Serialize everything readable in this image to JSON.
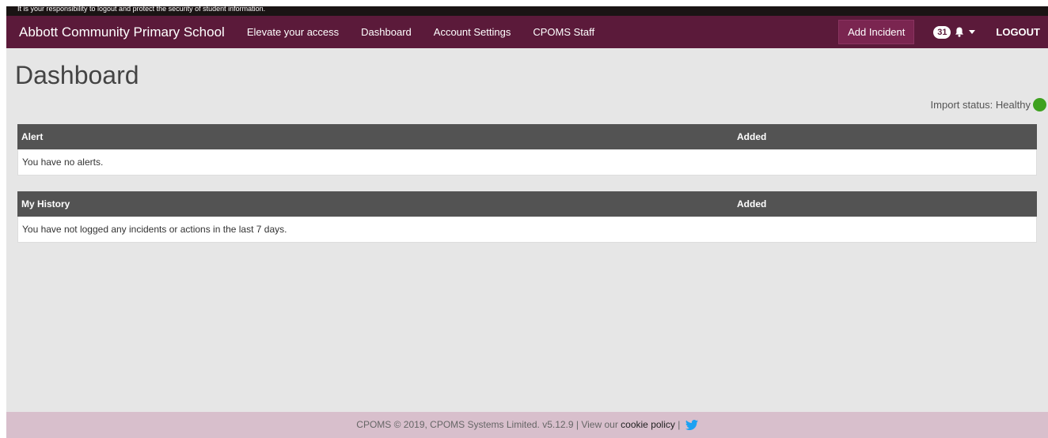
{
  "top_warning": "It is your responsibility to logout and protect the security of student information.",
  "navbar": {
    "brand": "Abbott Community Primary School",
    "links": [
      "Elevate your access",
      "Dashboard",
      "Account Settings",
      "CPOMS Staff"
    ],
    "add_incident": "Add Incident",
    "notification_count": "31",
    "logout": "LOGOUT"
  },
  "page": {
    "title": "Dashboard",
    "import_status": "Import status: Healthy"
  },
  "alerts_panel": {
    "col_a": "Alert",
    "col_b": "Added",
    "empty": "You have no alerts."
  },
  "history_panel": {
    "col_a": "My History",
    "col_b": "Added",
    "empty": "You have not logged any incidents or actions in the last 7 days."
  },
  "footer": {
    "text": "CPOMS © 2019, CPOMS Systems Limited. v5.12.9 | View our",
    "cookie_link": "cookie policy",
    "separator": "|"
  },
  "colors": {
    "navbar": "#5b1a3a",
    "panel_header": "#535353",
    "status_healthy": "#3ea11f",
    "footer": "#d8bfcc"
  },
  "icons": {
    "notification": "bell-icon",
    "dropdown": "caret-down-icon",
    "status": "status-dot",
    "social": "twitter-icon"
  }
}
